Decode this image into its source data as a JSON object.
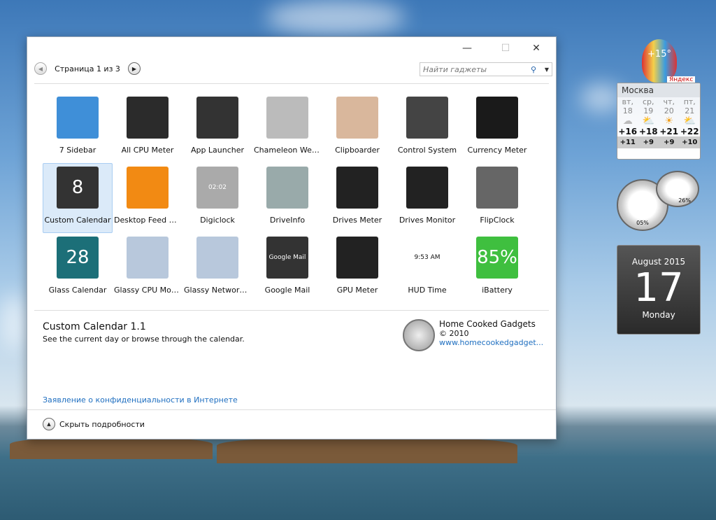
{
  "window": {
    "close": "✕",
    "maximize": "☐",
    "minimize": "—"
  },
  "nav": {
    "page": "Страница 1 из 3",
    "prev": "◀",
    "next": "▶"
  },
  "search": {
    "placeholder": "Найти гаджеты",
    "icon": "search-icon",
    "dropdown": "▼"
  },
  "gadgets": [
    {
      "label": "7 Sidebar",
      "color": "#3f8fd8"
    },
    {
      "label": "All CPU Meter",
      "color": "#2b2b2b"
    },
    {
      "label": "App Launcher",
      "color": "#333"
    },
    {
      "label": "Chameleon Weather",
      "color": "#bbb"
    },
    {
      "label": "Clipboarder",
      "color": "#d9b79c"
    },
    {
      "label": "Control System",
      "color": "#444"
    },
    {
      "label": "Currency Meter",
      "color": "#1a1a1a"
    },
    {
      "label": "Custom Calendar",
      "color": "#333",
      "text": "8"
    },
    {
      "label": "Desktop Feed Reader",
      "color": "#f28a13"
    },
    {
      "label": "Digiclock",
      "color": "#aaa",
      "text": "02:02"
    },
    {
      "label": "DriveInfo",
      "color": "#9aa"
    },
    {
      "label": "Drives Meter",
      "color": "#222"
    },
    {
      "label": "Drives Monitor",
      "color": "#222"
    },
    {
      "label": "FlipClock",
      "color": "#666"
    },
    {
      "label": "Glass Calendar",
      "color": "#1c6f78",
      "text": "28"
    },
    {
      "label": "Glassy CPU Monitor",
      "color": "#b8c8dc"
    },
    {
      "label": "Glassy Network Monitor",
      "color": "#b8c8dc"
    },
    {
      "label": "Google Mail",
      "color": "#333",
      "text": "Google Mail"
    },
    {
      "label": "GPU Meter",
      "color": "#222"
    },
    {
      "label": "HUD Time",
      "color": "#fff",
      "text": "9:53 AM"
    },
    {
      "label": "iBattery",
      "color": "#3fbf3f",
      "text": "85%"
    }
  ],
  "selected_index": 7,
  "details": {
    "title": "Custom Calendar 1.1",
    "description": "See the current day or browse through the calendar.",
    "author": "Home Cooked Gadgets",
    "copyright": "© 2010",
    "link": "www.homecookedgadget..."
  },
  "privacy_link": "Заявление о конфиденциальности в Интернете",
  "hide_details": "Скрыть подробности",
  "weather": {
    "current": "+15°",
    "provider": "Яндекс",
    "city": "Москва",
    "days": [
      {
        "day": "вт,",
        "date": "18",
        "icon": "cloud",
        "hi": "+16",
        "lo": "+11"
      },
      {
        "day": "ср,",
        "date": "19",
        "icon": "sun-cloud",
        "hi": "+18",
        "lo": "+9"
      },
      {
        "day": "чт,",
        "date": "20",
        "icon": "sun",
        "hi": "+21",
        "lo": "+9"
      },
      {
        "day": "пт,",
        "date": "21",
        "icon": "sun-cloud",
        "hi": "+22",
        "lo": "+10"
      }
    ]
  },
  "meter": {
    "cpu": "05%",
    "ram": "26%"
  },
  "calendar": {
    "month": "August 2015",
    "day": "17",
    "weekday": "Monday"
  }
}
